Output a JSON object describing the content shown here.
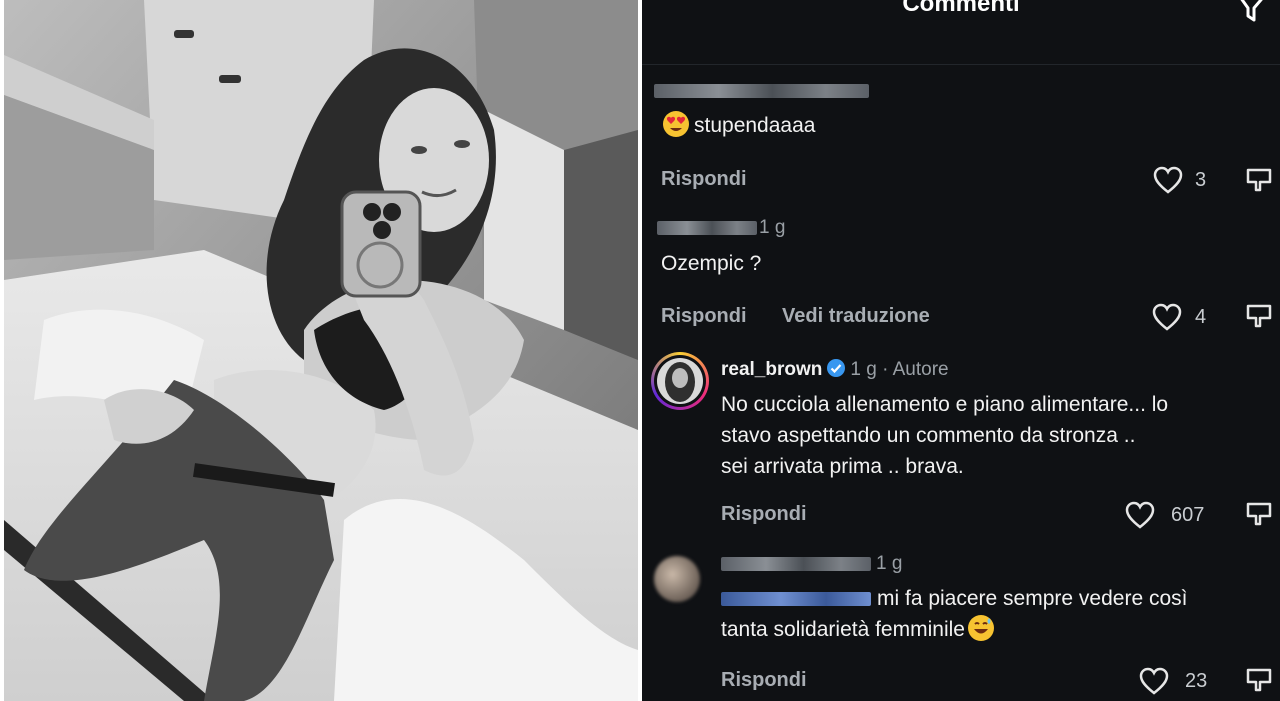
{
  "header": {
    "title": "Commenti"
  },
  "comments": [
    {
      "text": "stupendaaaa",
      "reply_label": "Rispondi",
      "likes": "3"
    },
    {
      "time": "1 g",
      "text": "Ozempic ?",
      "reply_label": "Rispondi",
      "translate_label": "Vedi traduzione",
      "likes": "4"
    },
    {
      "username": "real_brown",
      "time": "1 g",
      "author_badge": "· Autore",
      "text_lines": [
        "No cucciola allenamento e piano alimentare... lo",
        "stavo aspettando un commento da stronza ..",
        "sei arrivata prima .. brava."
      ],
      "reply_label": "Rispondi",
      "likes": "607"
    },
    {
      "time": "1 g",
      "text_line1": "mi fa piacere sempre vedere così",
      "text_line2": "tanta solidarietà femminile",
      "reply_label": "Rispondi",
      "likes": "23"
    }
  ],
  "icons": {
    "heart": "heart-icon",
    "dislike": "dislike-icon",
    "filter": "filter-icon",
    "verified": "verified-badge-icon"
  },
  "colors": {
    "background": "#0f1114",
    "text": "#f2f2f2",
    "muted": "#9aa0a6",
    "verified": "#3897f0"
  }
}
